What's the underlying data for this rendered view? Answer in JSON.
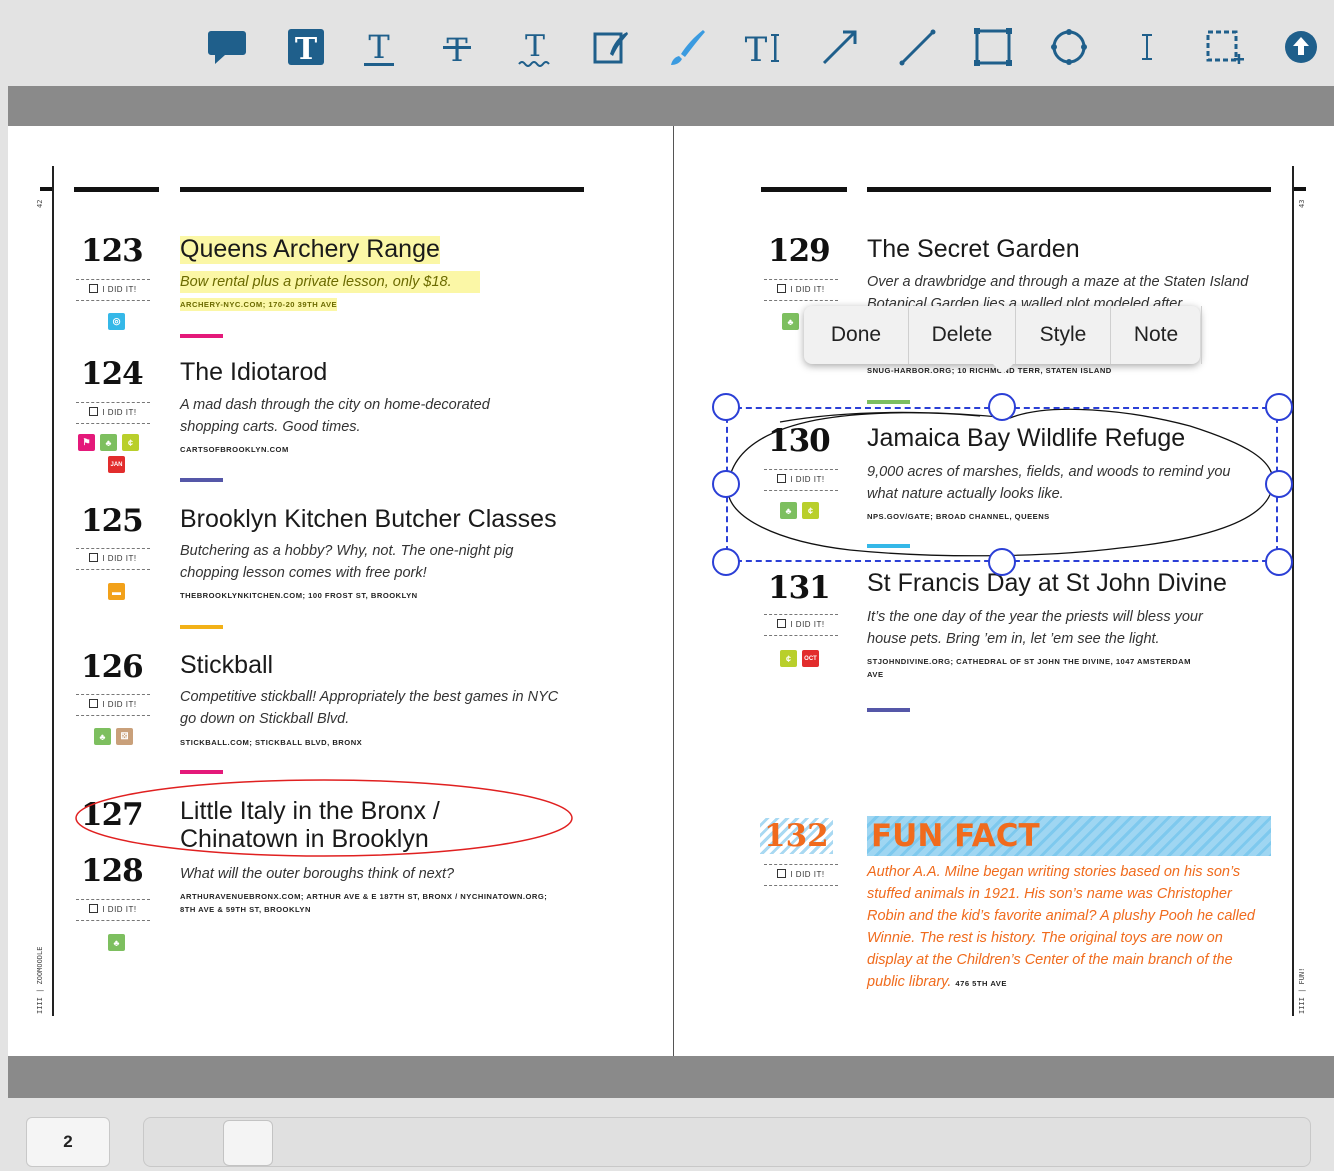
{
  "toolbar": {
    "tools": [
      {
        "name": "comment-tool-icon"
      },
      {
        "name": "text-highlight-tool-icon"
      },
      {
        "name": "underline-tool-icon"
      },
      {
        "name": "strikeout-tool-icon"
      },
      {
        "name": "squiggly-tool-icon"
      },
      {
        "name": "signature-tool-icon"
      },
      {
        "name": "freehand-tool-icon"
      },
      {
        "name": "free-text-tool-icon"
      },
      {
        "name": "arrow-tool-icon"
      },
      {
        "name": "line-tool-icon"
      },
      {
        "name": "rectangle-tool-icon"
      },
      {
        "name": "ellipse-tool-icon"
      },
      {
        "name": "text-select-tool-icon"
      },
      {
        "name": "area-select-tool-icon"
      },
      {
        "name": "upload-tool-icon"
      }
    ],
    "icon_color": "#1f5f8b",
    "brush_color": "#3b9be0"
  },
  "left_page": {
    "page_number": "42",
    "footer": "IIII | ZOOMOODLE",
    "entries": [
      {
        "num": "123",
        "title": "Queens Archery Range",
        "desc": "Bow rental plus a private lesson, only $18.",
        "src": "ARCHERY-NYC.COM; 170-20 39TH AVE",
        "did": "I DID IT!"
      },
      {
        "num": "124",
        "title": "The Idiotarod",
        "desc": "A mad dash through the city on home-decorated shopping carts. Good times.",
        "src": "CARTSOFBROOKLYN.COM",
        "did": "I DID IT!",
        "month": "JAN"
      },
      {
        "num": "125",
        "title": "Brooklyn Kitchen Butcher Classes",
        "desc": "Butchering as a hobby? Why, not. The one-night pig chopping lesson comes with free pork!",
        "src": "THEBROOKLYNKITCHEN.COM; 100 FROST ST, BROOKLYN",
        "did": "I DID IT!"
      },
      {
        "num": "126",
        "title": "Stickball",
        "desc": "Competitive stickball! Appropriately the best games in NYC go down on Stickball Blvd.",
        "src": "STICKBALL.COM; STICKBALL BLVD, BRONX",
        "did": "I DID IT!"
      },
      {
        "num_a": "127",
        "num_b": "128",
        "title": "Little Italy in the Bronx / Chinatown in Brooklyn",
        "desc": "What will the outer boroughs think of next?",
        "src": "ARTHURAVENUEBRONX.COM; ARTHUR AVE & E 187TH ST, BRONX / NYCHINATOWN.ORG; 8TH AVE & 59TH ST, BROOKLYN",
        "did": "I DID IT!"
      }
    ]
  },
  "right_page": {
    "page_number": "43",
    "footer": "IIII | FUN!",
    "entries": [
      {
        "num": "129",
        "title": "The Secret Garden",
        "desc": "Over a drawbridge and through a maze at the Staten Island Botanical Garden lies a walled plot modeled after",
        "src": "SNUG-HARBOR.ORG; 10  RICHMOND TERR, STATEN ISLAND",
        "did": "I DID IT!"
      },
      {
        "num": "130",
        "title": "Jamaica Bay Wildlife Refuge",
        "desc": "9,000 acres of marshes, fields, and woods to remind you what nature actually looks like.",
        "src": "NPS.GOV/GATE; BROAD CHANNEL, QUEENS",
        "did": "I DID IT!"
      },
      {
        "num": "131",
        "title": "St Francis Day at St John Divine",
        "desc": "It’s the one day of the year the priests will bless your house pets. Bring ’em in, let ’em see the light.",
        "src": "STJOHNDIVINE.ORG; CATHEDRAL OF ST JOHN THE DIVINE, 1047 AMSTERDAM AVE",
        "did": "I DID IT!",
        "month": "OCT"
      }
    ],
    "fun_fact": {
      "num": "132",
      "title": "FUN FACT",
      "did": "I DID IT!",
      "desc": "Author A.A. Milne began writing stories based on his son’s stuffed animals in 1921. His son’s name was Christopher Robin and the kid’s favorite animal? A plushy Pooh he called Winnie. The rest is history. The original toys are now on display at the Children’s Center of the main branch of the public library.",
      "src": "476 5TH AVE"
    }
  },
  "context_menu": {
    "done": "Done",
    "delete": "Delete",
    "style": "Style",
    "note": "Note"
  },
  "footer_bar": {
    "page_indicator": "2"
  },
  "colors": {
    "highlight": "#fbf7a6",
    "selection": "#2b3fd6",
    "red_ellipse": "#e02020",
    "fun_orange": "#f06b1d",
    "bar_pink": "#e4197a",
    "bar_purple": "#5557a8",
    "bar_yellow": "#f2b117",
    "bar_green": "#7dbf5f",
    "bar_cyan": "#35b8e8"
  }
}
